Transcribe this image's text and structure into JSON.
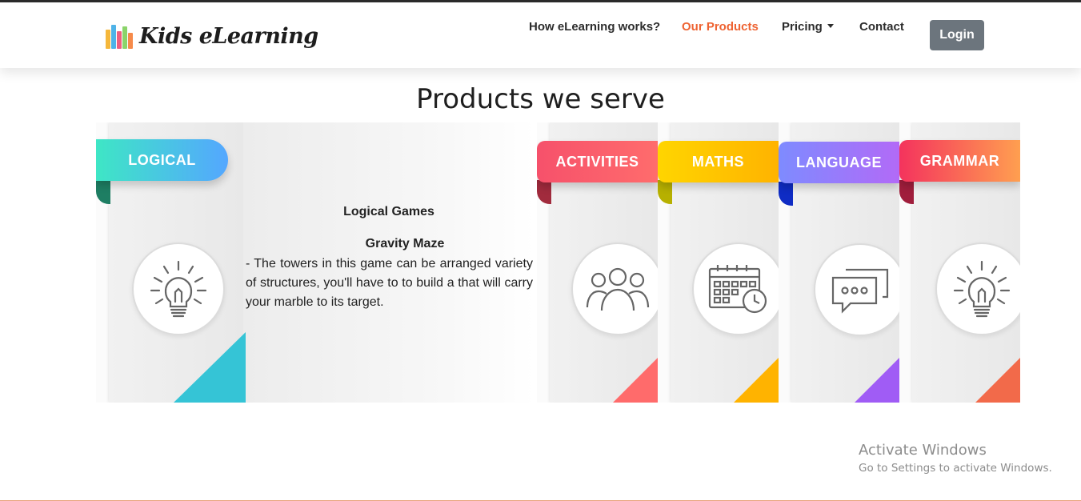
{
  "brand": {
    "name": "Kids eLearning",
    "logo_icon": "color-pencils-icon"
  },
  "nav": {
    "items": [
      {
        "label": "How eLearning works?",
        "active": false
      },
      {
        "label": "Our Products",
        "active": true
      },
      {
        "label": "Pricing",
        "dropdown": true,
        "active": false
      },
      {
        "label": "Contact",
        "active": false
      }
    ],
    "login_label": "Login",
    "active_color": "#ee6332"
  },
  "page": {
    "title": "Products we serve"
  },
  "cards": [
    {
      "label": "LOGICAL",
      "icon": "lightbulb-icon",
      "colors": [
        "#3ee6c5",
        "#54a7ff"
      ],
      "expanded": true
    },
    {
      "label": "ACTIVITIES",
      "icon": "people-group-icon",
      "colors": [
        "#f6516b",
        "#ff6c6c"
      ]
    },
    {
      "label": "MATHS",
      "icon": "calendar-clock-icon",
      "colors": [
        "#ffd500",
        "#ffb300"
      ]
    },
    {
      "label": "LANGUAGE",
      "icon": "chat-bubbles-icon",
      "colors": [
        "#7e8bff",
        "#b26af7"
      ]
    },
    {
      "label": "GRAMMAR",
      "icon": "lightbulb-icon",
      "colors": [
        "#f4335d",
        "#ff9f50"
      ]
    }
  ],
  "detail": {
    "title": "Logical Games",
    "subtitle": "Gravity Maze",
    "description": "- The towers in this game can be arranged variety of structures, you'll have to to build a that will carry your marble to its target."
  },
  "watermark": {
    "title": "Activate Windows",
    "subtitle": "Go to Settings to activate Windows."
  }
}
